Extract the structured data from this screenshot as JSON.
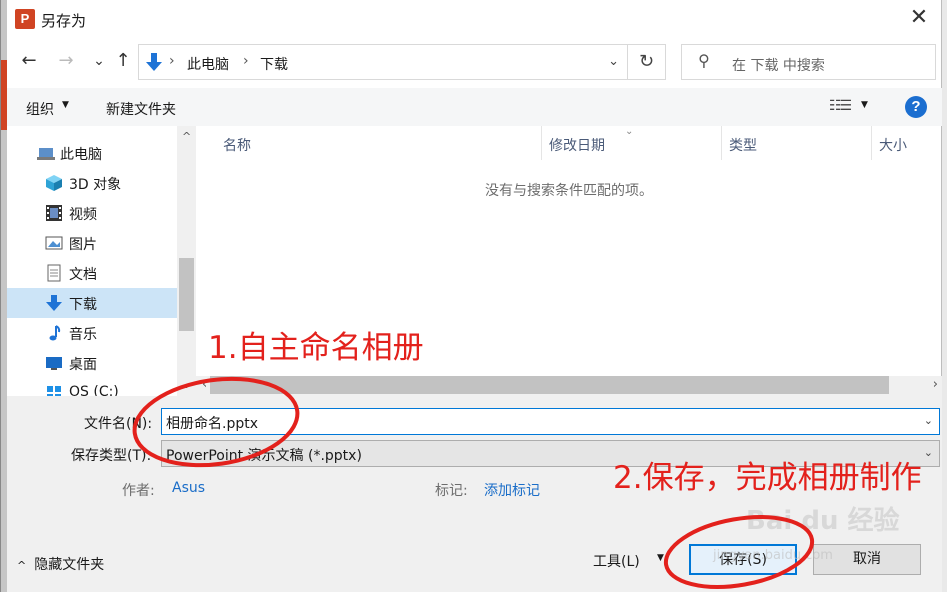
{
  "window": {
    "title": "另存为",
    "app_icon": "P"
  },
  "nav": {
    "back_icon": "←",
    "forward_icon": "→",
    "recent_icon": "⌄",
    "up_icon": "↑",
    "breadcrumb": [
      "此电脑",
      "下载"
    ],
    "refresh_icon": "↻",
    "search_placeholder": "在 下载 中搜索"
  },
  "toolbar": {
    "organize_label": "组织",
    "new_folder_label": "新建文件夹",
    "help_label": "?"
  },
  "sidebar": {
    "items": [
      {
        "label": "此电脑",
        "icon": "computer-icon"
      },
      {
        "label": "3D 对象",
        "icon": "cube-3d-icon"
      },
      {
        "label": "视频",
        "icon": "video-icon"
      },
      {
        "label": "图片",
        "icon": "picture-icon"
      },
      {
        "label": "文档",
        "icon": "document-icon"
      },
      {
        "label": "下载",
        "icon": "download-icon",
        "selected": true
      },
      {
        "label": "音乐",
        "icon": "music-icon"
      },
      {
        "label": "桌面",
        "icon": "desktop-icon"
      },
      {
        "label": "OS (C:)",
        "icon": "drive-icon"
      }
    ]
  },
  "file_list": {
    "columns": [
      "名称",
      "修改日期",
      "类型",
      "大小"
    ],
    "empty_message": "没有与搜索条件匹配的项。"
  },
  "form": {
    "filename_label": "文件名(N):",
    "filename_value": "相册命名.pptx",
    "filetype_label": "保存类型(T):",
    "filetype_value": "PowerPoint 演示文稿 (*.pptx)",
    "author_label": "作者:",
    "author_value": "Asus",
    "tags_label": "标记:",
    "tags_value": "添加标记"
  },
  "footer": {
    "hide_folders_label": "隐藏文件夹",
    "tools_label": "工具(L)",
    "save_label": "保存(S)",
    "cancel_label": "取消"
  },
  "annotations": {
    "step1": "1.自主命名相册",
    "step2": "2.保存，完成相册制作",
    "color": "#e3211c"
  },
  "watermark": {
    "text": "Bai du 经验",
    "url": "jingyan.baidu.com"
  }
}
